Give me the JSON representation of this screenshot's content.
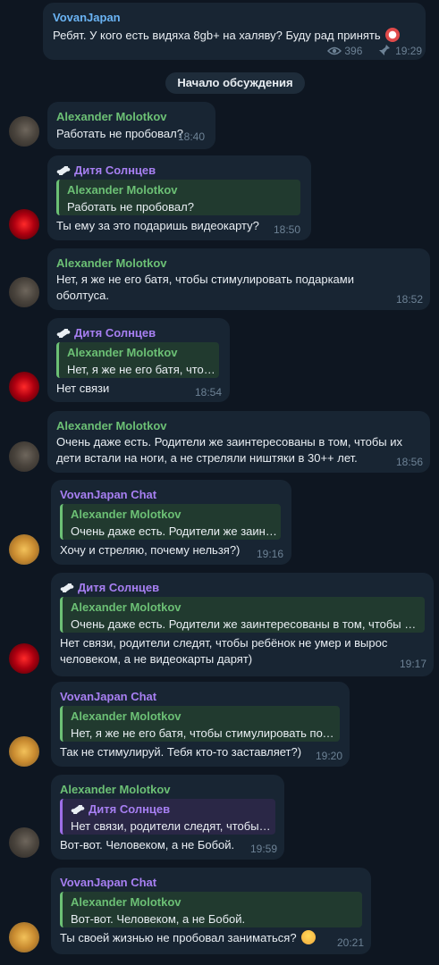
{
  "top_post": {
    "author": "VovanJapan",
    "text": "Ребят. У кого есть видяха 8gb+ на халяву? Буду рад принять",
    "views": "396",
    "time": "19:29"
  },
  "discussion_label": "Начало обсуждения",
  "messages": [
    {
      "author": "Alexander Molotkov",
      "lines": [
        "Работать не пробовал?"
      ],
      "time": "18:40"
    },
    {
      "author": "Дитя Солнцев",
      "reply_author": "Alexander Molotkov",
      "reply_text": "Работать не пробовал?",
      "lines": [
        "Ты ему за это подаришь видеокарту?"
      ],
      "time": "18:50"
    },
    {
      "author": "Alexander Molotkov",
      "lines": [
        "Нет, я же не его батя, чтобы стимулировать подарками",
        "оболтуса."
      ],
      "time": "18:52"
    },
    {
      "author": "Дитя Солнцев",
      "reply_author": "Alexander Molotkov",
      "reply_text": "Нет, я же не его батя, чтобы стимулировать подарками оболтуса.",
      "lines": [
        "Нет связи"
      ],
      "time": "18:54"
    },
    {
      "author": "Alexander Molotkov",
      "lines": [
        "Очень даже есть. Родители же заинтересованы в том, чтобы их",
        "дети встали на ноги, а не стреляли ништяки в 30++ лет."
      ],
      "time": "18:56"
    },
    {
      "author": "VovanJapan Chat",
      "reply_author": "Alexander Molotkov",
      "reply_text": "Очень даже есть. Родители же заинтересованы в том, чтобы их дети встали на ноги",
      "lines": [
        "Хочу и стреляю, почему нельзя?)"
      ],
      "time": "19:16"
    },
    {
      "author": "Дитя Солнцев",
      "reply_author": "Alexander Molotkov",
      "reply_text": "Очень даже есть. Родители же заинтересованы в том, чтобы их дети встали на ноги",
      "lines": [
        "Нет связи, родители следят, чтобы ребёнок не умер и вырос",
        "человеком, а не видеокарты дарят)"
      ],
      "time": "19:17"
    },
    {
      "author": "VovanJapan Chat",
      "reply_author": "Alexander Molotkov",
      "reply_text": "Нет, я же не его батя, чтобы стимулировать подарками оболтуса.",
      "lines": [
        "Так не стимулируй. Тебя кто-то заставляет?)"
      ],
      "time": "19:20"
    },
    {
      "author": "Alexander Molotkov",
      "reply_author": "Дитя Солнцев",
      "reply_text": "Нет связи, родители следят, чтобы ребёнок не умер и вырос",
      "lines": [
        "Вот-вот. Человеком, а не Бобой."
      ],
      "time": "19:59"
    },
    {
      "author": "VovanJapan Chat",
      "reply_author": "Alexander Molotkov",
      "reply_text": "Вот-вот. Человеком, а не Бобой.",
      "lines": [
        "Ты своей жизнью не пробовал заниматься?"
      ],
      "time": "20:21"
    }
  ]
}
